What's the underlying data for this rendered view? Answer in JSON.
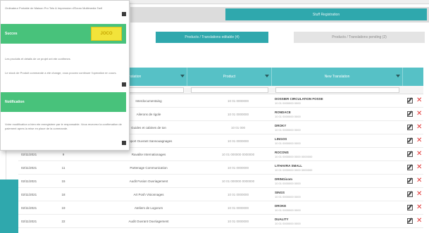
{
  "tabs": {
    "top_active": "Stuff Registration",
    "sub_active": "Products / Translations editable (4)",
    "sub_inactive": "Products / Translations pending (2)"
  },
  "table": {
    "headers": [
      "",
      "",
      "Translation",
      "Product",
      "New Translation"
    ],
    "rows": [
      {
        "date": "",
        "num": "",
        "name": "Interdocumentaing",
        "product": "10 01 0000000",
        "trans": "DOSSIER CIRCULATION FOSSE",
        "trans_sub": "10 01 0000000 0000"
      },
      {
        "date": "",
        "num": "",
        "name": "Ailerons de rigole",
        "product": "10 01 0000000",
        "trans": "RONDACE",
        "trans_sub": "10 01 0000000 0000"
      },
      {
        "date": "",
        "num": "",
        "name": "Guides et cabines de ton",
        "product": "10 01 000",
        "trans": "DROKY",
        "trans_sub": "10 01 0000000 0000"
      },
      {
        "date": "",
        "num": "",
        "name": "Support Ouvrant Sansouagnages",
        "product": "10 01 0000000",
        "trans": "LINGOS",
        "trans_sub": "10 01 0000000 0000"
      },
      {
        "date": "02/11/2021",
        "num": "9",
        "name": "Ravalite Internationages",
        "product": "10 01 000000 0000000",
        "trans": "ROCONS",
        "trans_sub": "10 01 0000000 0000 0000000"
      },
      {
        "date": "02/11/2021",
        "num": "11",
        "name": "Partenage Communication",
        "product": "10 01 0000000",
        "trans": "LITHAVRA SMALL",
        "trans_sub": "10 01 0000000 0000 0000000"
      },
      {
        "date": "02/11/2021",
        "num": "15",
        "name": "Audit Fusion Ouvriagement",
        "product": "10 01 000000 0000000",
        "trans": "DRINGicom",
        "trans_sub": "10 01 0000000 0000"
      },
      {
        "date": "02/11/2021",
        "num": "18",
        "name": "Art Posh Visionnages",
        "product": "10 01 0000000",
        "trans": "SINGS",
        "trans_sub": "10 01 0000000 0000"
      },
      {
        "date": "02/11/2021",
        "num": "19",
        "name": "Ateliers de Logorum",
        "product": "10 01 0000000",
        "trans": "DROKE",
        "trans_sub": "10 01 0000000 0000"
      },
      {
        "date": "02/11/2021",
        "num": "22",
        "name": "Audit Ouvrant Ouvriagement",
        "product": "10 01 0000000",
        "trans": "DUALITY",
        "trans_sub": "10 01 0000000 0000"
      }
    ]
  },
  "notifications": {
    "top_text": "Ordinateur Portable de Maison Pro Tels & Impression d'Ecran Multimedia Tarif",
    "banner1_label": "Succes",
    "logo_text": "JOCO",
    "mid_text_1": "Les produits et details de ce projet ont ete confirmes",
    "mid_text_2": "Le stock de Produit commande a ete change, vous pouvez continuer l'operation en cours.",
    "banner2_label": "Notification",
    "bottom_text": "Votre modification a bien ete enregistree par le responsable. Vous recevrez la confirmation de paiement apres la mise en place de la commande."
  },
  "colors": {
    "teal": "#2fa8ad",
    "header_teal": "#56c1c6",
    "green_banner": "#48c27b",
    "delete_red": "#e03535"
  }
}
